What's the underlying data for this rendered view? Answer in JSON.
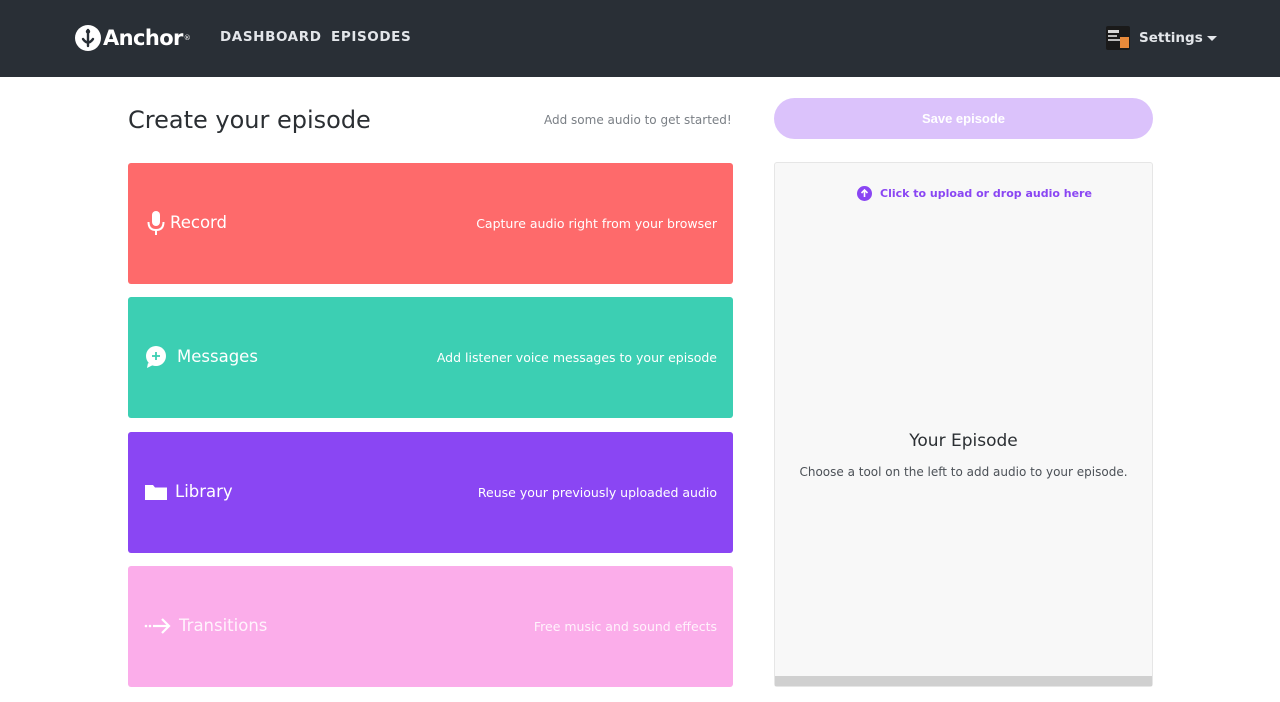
{
  "header": {
    "logo_text": "Anchor",
    "logo_mark": "®",
    "nav": [
      {
        "label": "DASHBOARD"
      },
      {
        "label": "EPISODES"
      }
    ],
    "settings_label": "Settings"
  },
  "main": {
    "title": "Create your episode",
    "hint": "Add some audio to get started!",
    "tools": [
      {
        "name": "Record",
        "description": "Capture audio right from your browser",
        "icon": "microphone-icon",
        "color": "#fe6a6b"
      },
      {
        "name": "Messages",
        "description": "Add listener voice messages to your episode",
        "icon": "message-plus-icon",
        "color": "#3ccfb3"
      },
      {
        "name": "Library",
        "description": "Reuse your previously uploaded audio",
        "icon": "folder-icon",
        "color": "#8a46f3"
      },
      {
        "name": "Transitions",
        "description": "Free music and sound effects",
        "icon": "transition-arrow-icon",
        "color": "#fbadea"
      }
    ]
  },
  "episode": {
    "save_label": "Save episode",
    "upload_text": "Click to upload or drop audio here",
    "title": "Your Episode",
    "subtitle": "Choose a tool on the left to add audio to your episode."
  },
  "colors": {
    "topbar": "#292f36",
    "accent": "#8a46f3",
    "save_disabled": "#dbc2fb"
  }
}
